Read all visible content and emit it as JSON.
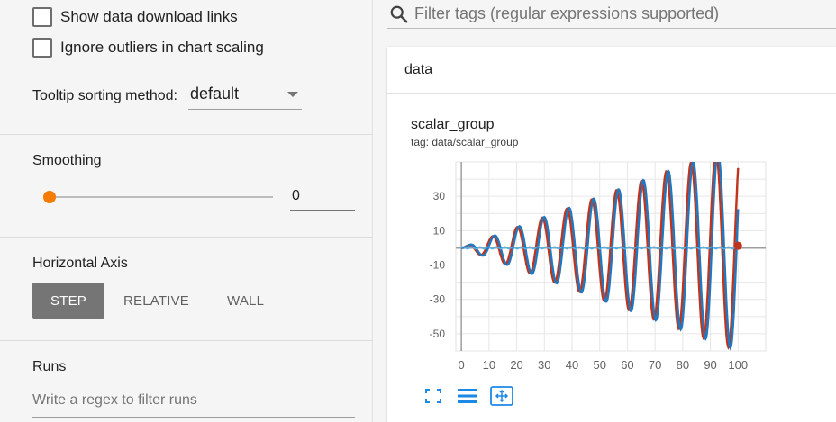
{
  "sidebar": {
    "show_download_links": "Show data download links",
    "ignore_outliers": "Ignore outliers in chart scaling",
    "tooltip_label": "Tooltip sorting method:",
    "tooltip_value": "default",
    "smoothing_title": "Smoothing",
    "smoothing_value": "0",
    "horizontal_axis_title": "Horizontal Axis",
    "axis_options": [
      "STEP",
      "RELATIVE",
      "WALL"
    ],
    "axis_selected": "STEP",
    "runs_title": "Runs",
    "runs_placeholder": "Write a regex to filter runs"
  },
  "main": {
    "filter_placeholder": "Filter tags (regular expressions supported)",
    "group_header": "data",
    "card_title": "scalar_group",
    "card_tag": "tag: data/scalar_group"
  },
  "colors": {
    "accent": "#f57c00",
    "series_red": "#c0341d",
    "series_blue": "#1f78c0",
    "series_light": "#4fb3e8"
  },
  "chart_data": {
    "type": "line",
    "x_ticks": [
      0,
      10,
      20,
      30,
      40,
      50,
      60,
      70,
      80,
      90,
      100
    ],
    "y_ticks": [
      30,
      10,
      -10,
      -30,
      -50
    ],
    "xlim": [
      -2,
      110
    ],
    "ylim": [
      -60,
      50
    ],
    "series": [
      {
        "color": "#c0341d",
        "x_range": [
          0,
          100
        ],
        "form": "0.6*x*sin(0.7*x)"
      },
      {
        "color": "#1f78c0",
        "x_range": [
          0,
          100
        ],
        "form": "0.6*x*sin(0.7*x - 0.5)"
      },
      {
        "color": "#4fb3e8",
        "x_range": [
          0,
          100
        ],
        "form": "~0"
      }
    ]
  }
}
